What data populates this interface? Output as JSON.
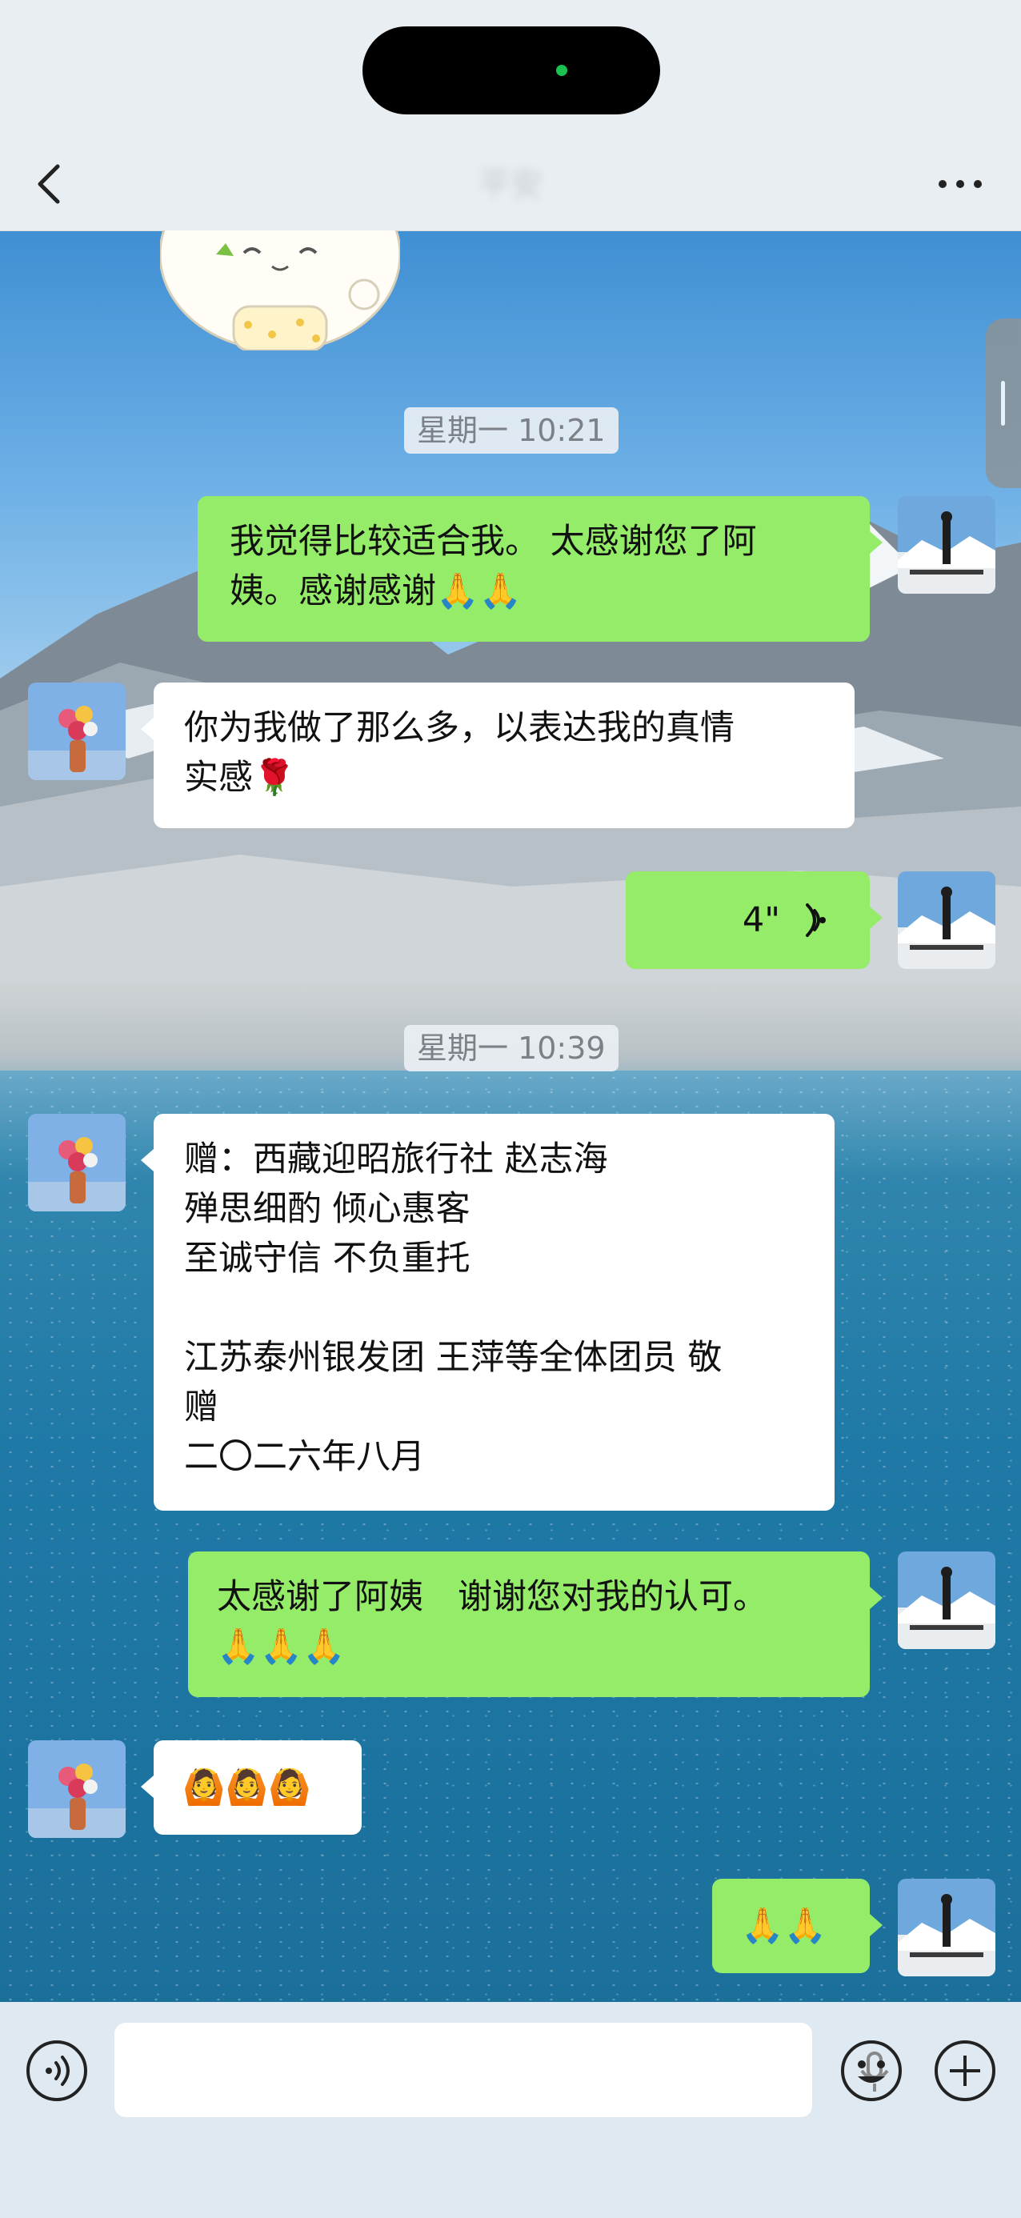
{
  "app": {
    "title": "平安"
  },
  "messages": [
    {
      "kind": "time",
      "text": "星期一 10:21"
    },
    {
      "kind": "out",
      "lines": [
        "我觉得比较适合我。 太感谢您了阿",
        "姨。感谢感谢🙏🙏"
      ]
    },
    {
      "kind": "in",
      "lines": [
        "你为我做了那么多，以表达我的真情",
        "实感🌹"
      ]
    },
    {
      "kind": "voice",
      "duration": "4\""
    },
    {
      "kind": "time",
      "text": "星期一 10:39"
    },
    {
      "kind": "in",
      "lines": [
        "赠：西藏迎昭旅行社 赵志海",
        "殚思细酌 倾心惠客",
        "至诚守信 不负重托",
        "",
        "江苏泰州银发团 王萍等全体团员 敬",
        "赠",
        "二〇二六年八月"
      ]
    },
    {
      "kind": "out",
      "lines": [
        "太感谢了阿姨　谢谢您对我的认可。",
        "🙏🙏🙏"
      ]
    },
    {
      "kind": "in",
      "lines": [
        "🙆🙆🙆"
      ]
    },
    {
      "kind": "out",
      "lines": [
        "🙏🙏"
      ]
    }
  ],
  "icons": {
    "back": "chevron-left-icon",
    "more": "more-icon",
    "voice_toggle": "voice-icon",
    "mic": "microphone-icon",
    "emoji": "emoji-icon",
    "plus": "plus-icon"
  },
  "colors": {
    "outgoing_bubble": "#95ec69",
    "incoming_bubble": "#ffffff"
  }
}
